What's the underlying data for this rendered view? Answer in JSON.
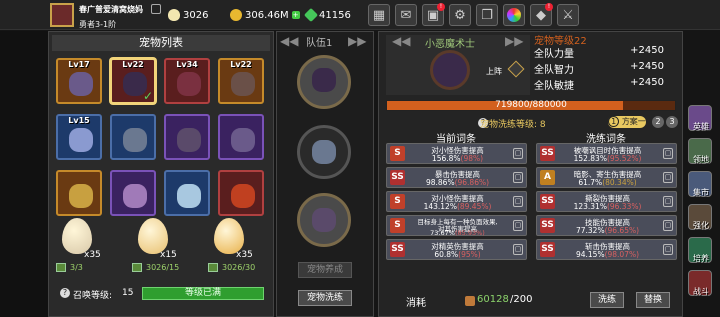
{
  "player": {
    "name": "春广普爱清窝烧妈",
    "rank": "勇者3-1阶"
  },
  "currency": {
    "eggs": "3026",
    "gold": "306.46M",
    "gems": "41156"
  },
  "toolbar": {
    "icons": [
      "shop-icon",
      "mail-icon",
      "bag-icon",
      "gear-icon",
      "gift-icon",
      "wheel-icon",
      "crystal-icon",
      "battle-icon"
    ]
  },
  "pet_list": {
    "title": "宠物列表",
    "pets": [
      {
        "lv": "Lv17",
        "rarity": "orange",
        "color": "#6a5a8a"
      },
      {
        "lv": "Lv22",
        "rarity": "red",
        "color": "#3a2a4a",
        "selected": true,
        "checked": true
      },
      {
        "lv": "Lv34",
        "rarity": "red",
        "color": "#7a3040"
      },
      {
        "lv": "Lv22",
        "rarity": "orange",
        "color": "#6a5048"
      },
      {
        "lv": "Lv15",
        "rarity": "blue",
        "color": "#8a9ad0"
      },
      {
        "lv": "",
        "rarity": "blue",
        "color": "#6a7890"
      },
      {
        "lv": "",
        "rarity": "purple",
        "color": "#5a4a6a"
      },
      {
        "lv": "",
        "rarity": "purple",
        "color": "#6a5a8a"
      },
      {
        "lv": "",
        "rarity": "orange",
        "color": "#c8a040"
      },
      {
        "lv": "",
        "rarity": "purple",
        "color": "#a07ab8"
      },
      {
        "lv": "",
        "rarity": "blue",
        "color": "#a8c8e0"
      },
      {
        "lv": "",
        "rarity": "red",
        "color": "#c04020"
      }
    ]
  },
  "eggs": [
    {
      "count": "x35",
      "sub": "3/3",
      "color": "#d8c8a8"
    },
    {
      "count": "x15",
      "sub": "3026/15",
      "color": "#e8c070"
    },
    {
      "count": "x35",
      "sub": "3026/30",
      "color": "#e8b048"
    }
  ],
  "summon": {
    "label": "召唤等级:",
    "level": "15",
    "status": "等级已满"
  },
  "team": {
    "title": "队伍1",
    "hatch_btn": "宠物养成",
    "wash_btn": "宠物洗练"
  },
  "pet": {
    "name": "小恶魔术士",
    "position": "上阵",
    "level": "宠物等级22",
    "stats": [
      {
        "name": "全队力量",
        "value": "+2450"
      },
      {
        "name": "全队智力",
        "value": "+2450"
      },
      {
        "name": "全队敏捷",
        "value": "+2450"
      }
    ],
    "exp_text": "719800/880000",
    "exp_fraction": 0.818
  },
  "wash": {
    "label": "宠物洗练等级:",
    "level": "8",
    "scheme": "方案一",
    "pages": [
      "2",
      "3"
    ],
    "col_left": "当前词条",
    "col_right": "洗练词条",
    "left": [
      {
        "l1": "对小怪伤害提高",
        "l2a": "156.8%",
        "l2b": "(98%)",
        "icon": "S",
        "ic": "#c0402a",
        "hl": "hl"
      },
      {
        "l1": "暴击伤害提高",
        "l2a": "98.86%",
        "l2b": "(96.86%)",
        "icon": "SS",
        "ic": "#b03030",
        "hl": "hl"
      },
      {
        "l1": "对小怪伤害提高",
        "l2a": "143.12%",
        "l2b": "(89.45%)",
        "icon": "S",
        "ic": "#c0402a",
        "hl": "hl"
      },
      {
        "l1": "目标身上每有一种负面效果,",
        "l1b": "对其伤害提高",
        "l2a": "73.67%",
        "l2b": "(85.93%)",
        "icon": "S",
        "ic": "#c0402a",
        "hl": "hl"
      },
      {
        "l1": "对精英伤害提高",
        "l2a": "60.8%",
        "l2b": "(95%)",
        "icon": "SS",
        "ic": "#b03030",
        "hl": "hl"
      }
    ],
    "right": [
      {
        "l1": "被嘲讽目时伤害提高",
        "l2a": "152.83%",
        "l2b": "(95.52%)",
        "icon": "SS",
        "ic": "#b03030",
        "hl": "hl"
      },
      {
        "l1": "暗影、寄生伤害提高",
        "l2a": "61.7%",
        "l2b": "(80.34%)",
        "icon": "A",
        "ic": "#c08020",
        "hl": "hl2"
      },
      {
        "l1": "撕裂伤害提高",
        "l2a": "123.31%",
        "l2b": "(96.33%)",
        "icon": "SS",
        "ic": "#b03030",
        "hl": "hl"
      },
      {
        "l1": "技能伤害提高",
        "l2a": "77.32%",
        "l2b": "(96.65%)",
        "icon": "SS",
        "ic": "#b03030",
        "hl": "hl"
      },
      {
        "l1": "斩击伤害提高",
        "l2a": "94.15%",
        "l2b": "(98.07%)",
        "icon": "SS",
        "ic": "#b03030",
        "hl": "hl"
      }
    ],
    "consume_label": "消耗",
    "cost": "60128",
    "cost_need": "/200",
    "wash_btn": "洗练",
    "swap_btn": "替换"
  },
  "side_menu": [
    {
      "label": "英雄",
      "icon": "hero-icon",
      "color": "#6a4a8a"
    },
    {
      "label": "领地",
      "icon": "territory-icon",
      "color": "#4a6a4a"
    },
    {
      "label": "集市",
      "icon": "market-icon",
      "color": "#4a5a7a"
    },
    {
      "label": "强化",
      "icon": "enhance-icon",
      "color": "#5a4a3a"
    },
    {
      "label": "培养",
      "icon": "cultivate-icon",
      "color": "#2a6a4a"
    },
    {
      "label": "战斗",
      "icon": "battle-icon",
      "color": "#7a2a2a"
    }
  ]
}
